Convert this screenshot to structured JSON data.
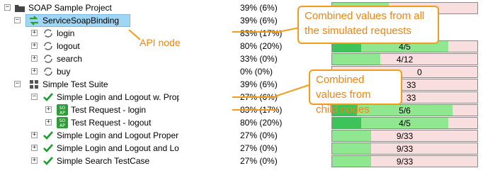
{
  "rows": [
    {
      "label": "SOAP Sample Project",
      "pct": "39% (6%)",
      "icon": "folder-icon"
    },
    {
      "label": "ServiceSoapBinding",
      "pct": "39% (6%)",
      "icon": "arrows-icon"
    },
    {
      "label": "login",
      "pct": "83% (17%)",
      "icon": "refresh-icon"
    },
    {
      "label": "logout",
      "pct": "80% (20%)",
      "icon": "refresh-icon",
      "bar": "4/5",
      "fill": 0.8
    },
    {
      "label": "search",
      "pct": "33% (0%)",
      "icon": "refresh-icon",
      "bar": "4/12",
      "fill": 0.33
    },
    {
      "label": "buy",
      "pct": "0% (0%)",
      "icon": "refresh-icon",
      "bar": "0",
      "fill": 0
    },
    {
      "label": "Simple Test Suite",
      "pct": "39% (6%)",
      "icon": "grid-icon",
      "bar": "33",
      "fill": 0.39
    },
    {
      "label": "Simple Login and Logout w. Prop",
      "pct": "27% (6%)",
      "icon": "check-icon",
      "bar": "33",
      "fill": 0.27
    },
    {
      "label": "Test Request - login",
      "pct": "83% (17%)",
      "icon": "soap-icon",
      "bar": "5/6",
      "fill": 0.83
    },
    {
      "label": "Test Request - logout",
      "pct": "80% (20%)",
      "icon": "soap-icon",
      "bar": "4/5",
      "fill": 0.8
    },
    {
      "label": "Simple Login and Logout Proper",
      "pct": "27% (0%)",
      "icon": "check-icon",
      "bar": "9/33",
      "fill": 0.27
    },
    {
      "label": "Simple Login and Logout and Lo",
      "pct": "27% (0%)",
      "icon": "check-icon",
      "bar": "9/33",
      "fill": 0.27
    },
    {
      "label": "Simple Search TestCase",
      "pct": "27% (0%)",
      "icon": "check-icon",
      "bar": "9/33",
      "fill": 0.27
    }
  ],
  "callouts": {
    "combined_requests": "Combined values from all the simulated requests",
    "combined_child": "Combined values from child nodes",
    "api_node": "API node"
  },
  "colors": {
    "accent": "#f39c1c",
    "pass": "#8fe88f",
    "fail": "#f8dede",
    "selected": "#9fd5f5"
  }
}
